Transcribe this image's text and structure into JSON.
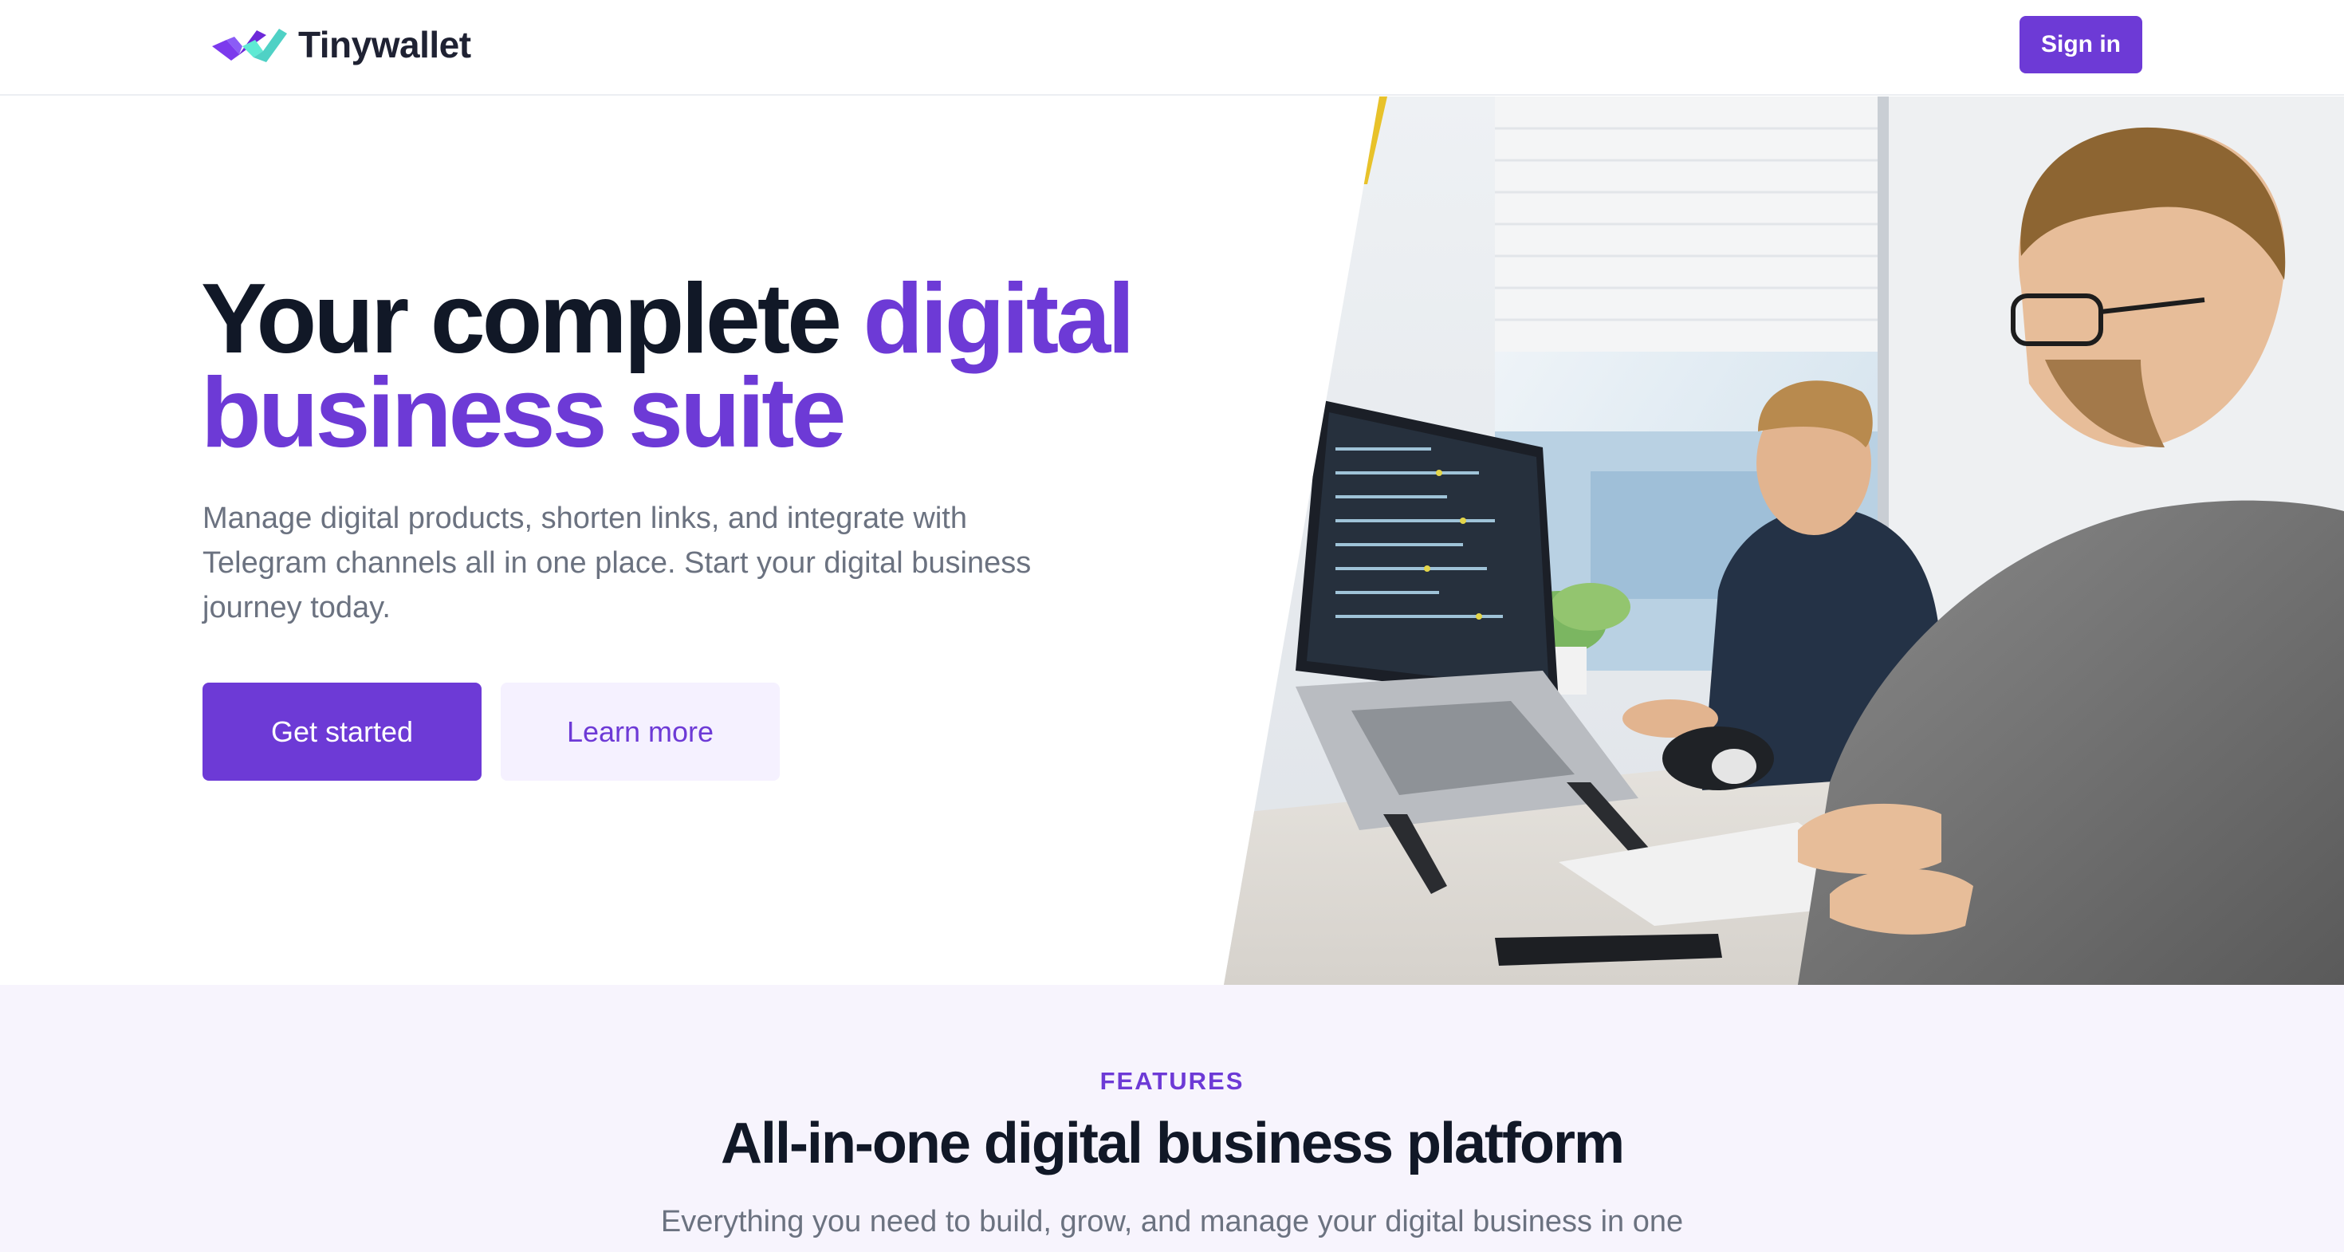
{
  "header": {
    "brand": "Tinywallet",
    "signin_label": "Sign in"
  },
  "hero": {
    "title_part1": "Your complete ",
    "title_accent": "digital business suite",
    "description": "Manage digital products, shorten links, and integrate with Telegram channels all in one place. Start your digital business journey today.",
    "primary_cta": "Get started",
    "secondary_cta": "Learn more"
  },
  "features": {
    "eyebrow": "FEATURES",
    "title": "All-in-one digital business platform",
    "subtitle": "Everything you need to build, grow, and manage your digital business in one"
  },
  "colors": {
    "accent": "#6d3ad6",
    "accent_light": "#f5f1ff",
    "features_bg": "#f7f4fd",
    "logo_teal": "#4fd1c5"
  }
}
